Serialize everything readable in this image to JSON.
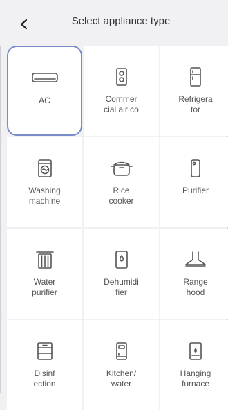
{
  "header": {
    "title": "Select appliance type",
    "back_icon": "chevron-left-icon"
  },
  "appliances": [
    {
      "label": "AC",
      "icon": "air-conditioner-icon",
      "selected": true
    },
    {
      "label": "Commer\ncial air co",
      "icon": "commercial-ac-icon",
      "selected": false
    },
    {
      "label": "Refrigera\ntor",
      "icon": "refrigerator-icon",
      "selected": false
    },
    {
      "label": "Washing\nmachine",
      "icon": "washing-machine-icon",
      "selected": false
    },
    {
      "label": "Rice\ncooker",
      "icon": "rice-cooker-icon",
      "selected": false
    },
    {
      "label": "Purifier",
      "icon": "purifier-icon",
      "selected": false
    },
    {
      "label": "Water\npurifier",
      "icon": "water-purifier-icon",
      "selected": false
    },
    {
      "label": "Dehumidi\nfier",
      "icon": "dehumidifier-icon",
      "selected": false
    },
    {
      "label": "Range\nhood",
      "icon": "range-hood-icon",
      "selected": false
    },
    {
      "label": "Disinf\nection",
      "icon": "disinfection-cabinet-icon",
      "selected": false
    },
    {
      "label": "Kitchen/\nwater",
      "icon": "kitchen-water-icon",
      "selected": false
    },
    {
      "label": "Hanging\nfurnace",
      "icon": "hanging-furnace-icon",
      "selected": false
    }
  ],
  "colors": {
    "selected_border": "#7a8cc8",
    "background": "#f1f1f3",
    "tile": "#ffffff"
  }
}
